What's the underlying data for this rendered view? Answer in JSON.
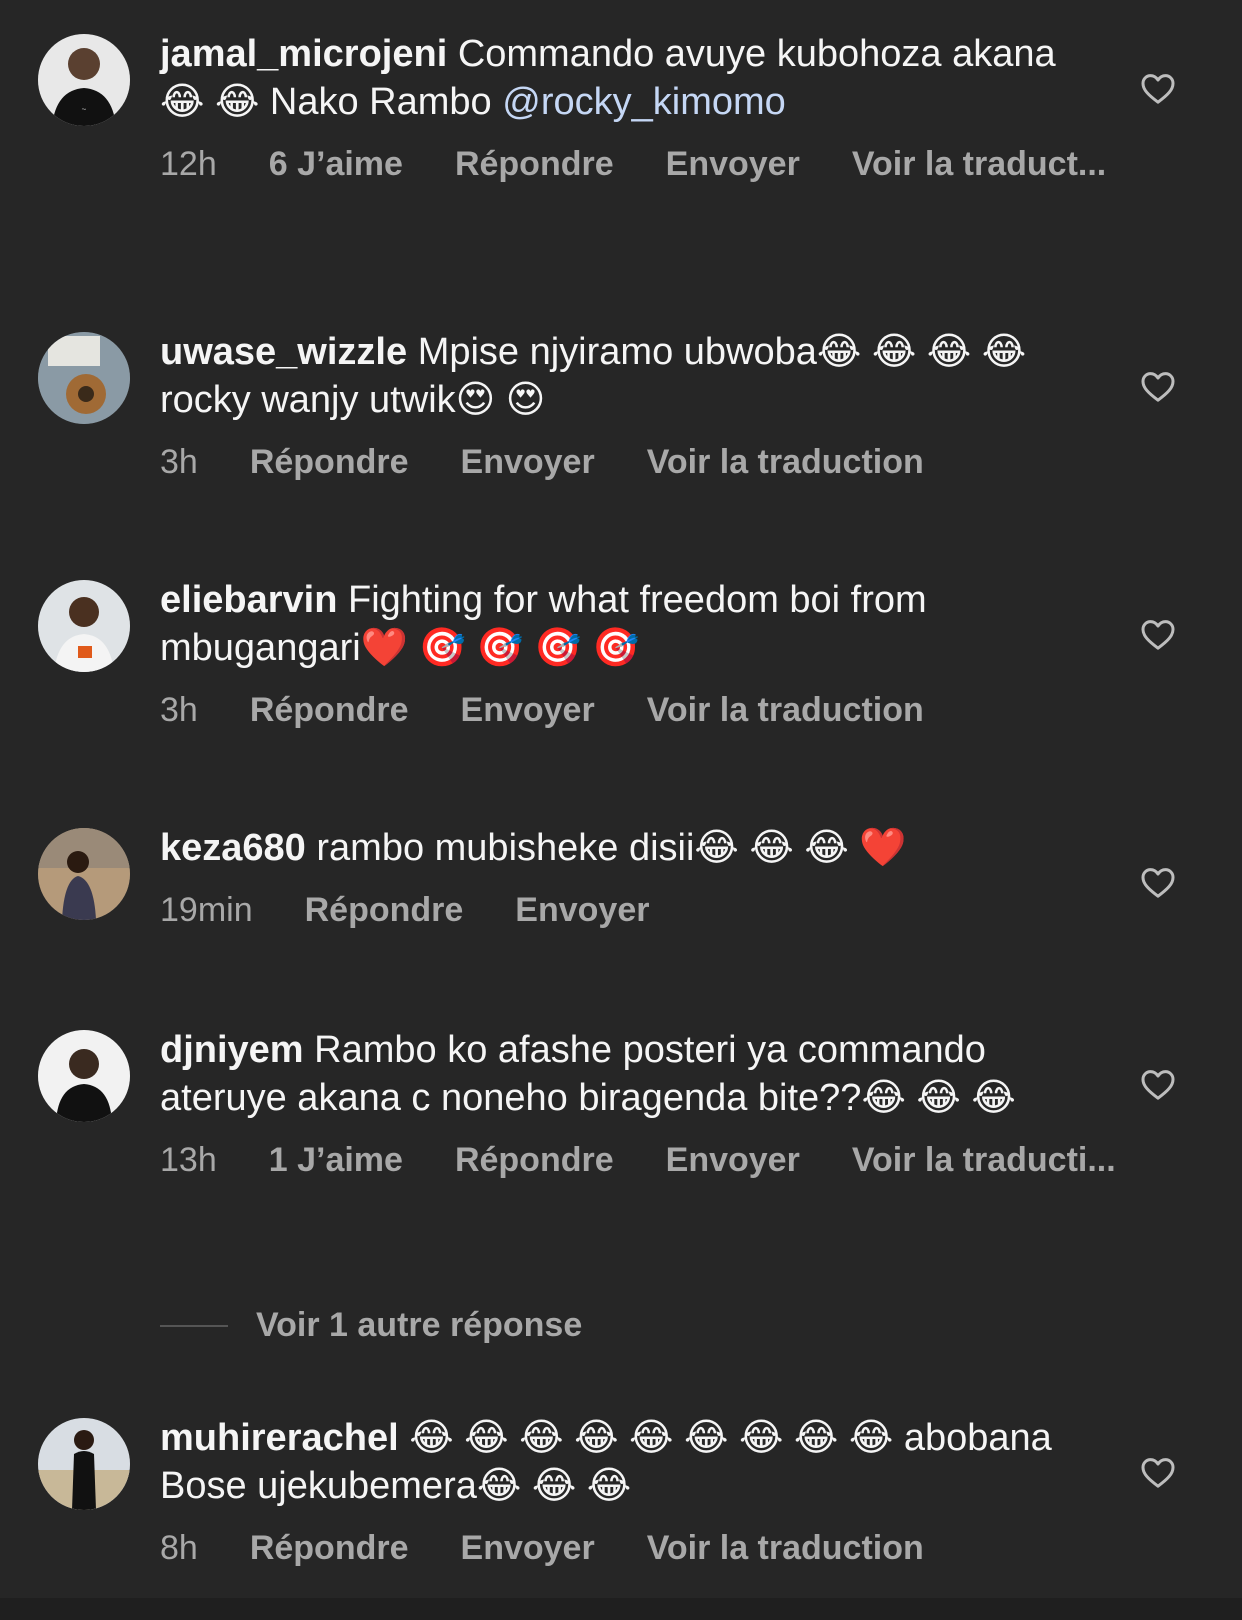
{
  "comments": [
    {
      "username": "jamal_microjeni",
      "text": "Commando avuye kubohoza akana😂 😂 Nako Rambo ",
      "mention": "@rocky_kimomo",
      "time": "12h",
      "likes": "6 J’aime",
      "reply": "Répondre",
      "send": "Envoyer",
      "translate": "Voir la traduct..."
    },
    {
      "username": "uwase_wizzle",
      "text": "Mpise njyiramo ubwoba😂 😂 😂 😂 rocky wanjy utwik😍 😍",
      "time": "3h",
      "reply": "Répondre",
      "send": "Envoyer",
      "translate": "Voir la traduction"
    },
    {
      "username": "eliebarvin",
      "text": "Fighting for what freedom boi from mbugangari❤️ 🎯 🎯 🎯 🎯",
      "time": "3h",
      "reply": "Répondre",
      "send": "Envoyer",
      "translate": "Voir la traduction"
    },
    {
      "username": "keza680",
      "text": "rambo mubisheke disii😂 😂 😂 ❤️",
      "time": "19min",
      "reply": "Répondre",
      "send": "Envoyer"
    },
    {
      "username": "djniyem",
      "text": "Rambo ko afashe posteri ya commando ateruye akana c noneho biragenda bite??😂 😂 😂",
      "time": "13h",
      "likes": "1 J’aime",
      "reply": "Répondre",
      "send": "Envoyer",
      "translate": "Voir la traducti..."
    },
    {
      "username": "muhirerachel",
      "text": "😂 😂 😂 😂 😂 😂 😂 😂 😂 abobana Bose ujekubemera😂 😂 😂",
      "time": "8h",
      "reply": "Répondre",
      "send": "Envoyer",
      "translate": "Voir la traduction"
    }
  ],
  "view_replies": "Voir 1 autre réponse",
  "icons": {
    "like": "heart-outline-icon",
    "avatar": "avatar"
  },
  "colors": {
    "background": "#262626",
    "text": "#f5f5f5",
    "meta": "#a8a8a8",
    "mention": "#c5d7f5"
  }
}
